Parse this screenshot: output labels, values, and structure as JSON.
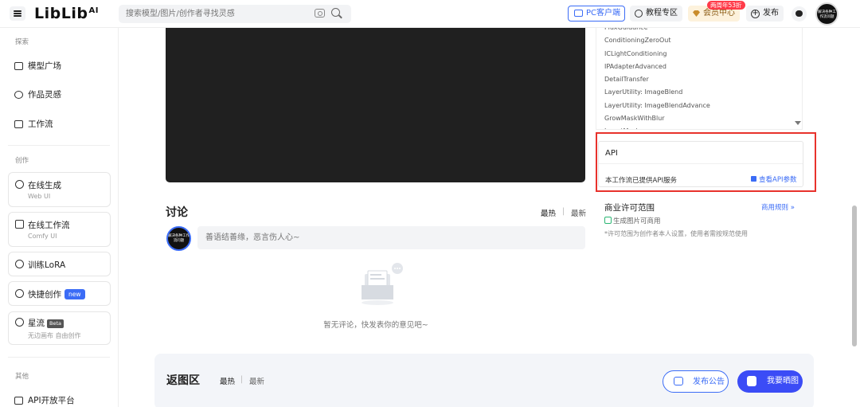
{
  "header": {
    "logo_text": "LibLib",
    "logo_sup": "AI",
    "search_placeholder": "搜索模型/图片/创作者寻找灵感",
    "pc_client": "PC客户端",
    "tutorial": "教程专区",
    "member": "会员中心",
    "member_badge": "两周年53折",
    "publish": "发布",
    "avatar_text": "解决各种工作流问题"
  },
  "sidebar": {
    "section_explore": "探索",
    "model_square": "模型广场",
    "inspiration": "作品灵感",
    "workflow": "工作流",
    "section_create": "创作",
    "online_gen": "在线生成",
    "online_gen_sub": "Web UI",
    "online_workflow": "在线工作流",
    "online_workflow_sub": "Comfy UI",
    "train_lora": "训练LoRA",
    "quick_create": "快捷创作",
    "quick_create_tag": "new",
    "xingliu": "星流",
    "xingliu_tag": "Beta",
    "xingliu_sub": "无边画布 自由创作",
    "section_other": "其他",
    "api_platform": "API开放平台"
  },
  "discussion": {
    "title": "讨论",
    "sort_hot": "最热",
    "sort_sep": "|",
    "sort_new": "最新",
    "input_placeholder": "善语结善缘，恶言伤人心~",
    "empty_text": "暂无评论，快发表你的意见吧~"
  },
  "nodes": {
    "items": [
      "FluxGuidance",
      "ConditioningZeroOut",
      "ICLightConditioning",
      "IPAdapterAdvanced",
      "DetailTransfer",
      "LayerUtility: ImageBlend",
      "LayerUtility: ImageBlendAdvance",
      "GrowMaskWithBlur",
      "InvertMask"
    ]
  },
  "api": {
    "title": "API",
    "desc": "本工作流已提供API服务",
    "link": "查看API参数"
  },
  "license": {
    "title": "商业许可范围",
    "rule_link": "商用规则 »",
    "item": "生成图片可商用",
    "note": "*许可范围为创作者本人设置，使用者需按规范使用"
  },
  "return_area": {
    "title": "返图区",
    "sort_hot": "最热",
    "sort_sep": "|",
    "sort_new": "最新",
    "announce_btn": "发布公告",
    "show_btn": "我要晒图"
  },
  "colors": {
    "accent": "#3b6cf6",
    "highlight": "#e8322c"
  }
}
